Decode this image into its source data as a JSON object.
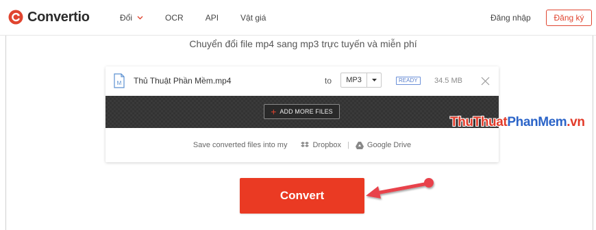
{
  "header": {
    "logo_text": "Convertio",
    "nav": [
      {
        "label": "Đổi",
        "has_dropdown": true
      },
      {
        "label": "OCR",
        "has_dropdown": false
      },
      {
        "label": "API",
        "has_dropdown": false
      },
      {
        "label": "Vật giá",
        "has_dropdown": false
      }
    ],
    "login_label": "Đăng nhập",
    "signup_label": "Đăng ký"
  },
  "subtitle": "Chuyển đổi file mp4 sang mp3 trực tuyến và miễn phí",
  "file": {
    "name": "Thủ Thuật Phần Mềm.mp4",
    "icon_letter": "M",
    "to_label": "to",
    "format": "MP3",
    "status": "READY",
    "size": "34.5 MB"
  },
  "add_more_label": "ADD MORE FILES",
  "save": {
    "label": "Save converted files into my",
    "dropbox": "Dropbox",
    "separator": "|",
    "gdrive": "Google Drive"
  },
  "watermark": {
    "part1": "ThuThuat",
    "part2": "PhanMem",
    "part3": ".vn"
  },
  "convert_label": "Convert",
  "colors": {
    "brand_red": "#ea3a23",
    "ready_blue": "#5a7fcc",
    "watermark_red": "#e23b2a",
    "watermark_blue": "#2b64c8"
  },
  "icons": [
    "convertio-logo-icon",
    "chevron-down-icon",
    "file-icon",
    "caret-down-icon",
    "close-icon",
    "plus-icon",
    "dropbox-icon",
    "google-drive-icon",
    "arrow-annotation-icon"
  ]
}
